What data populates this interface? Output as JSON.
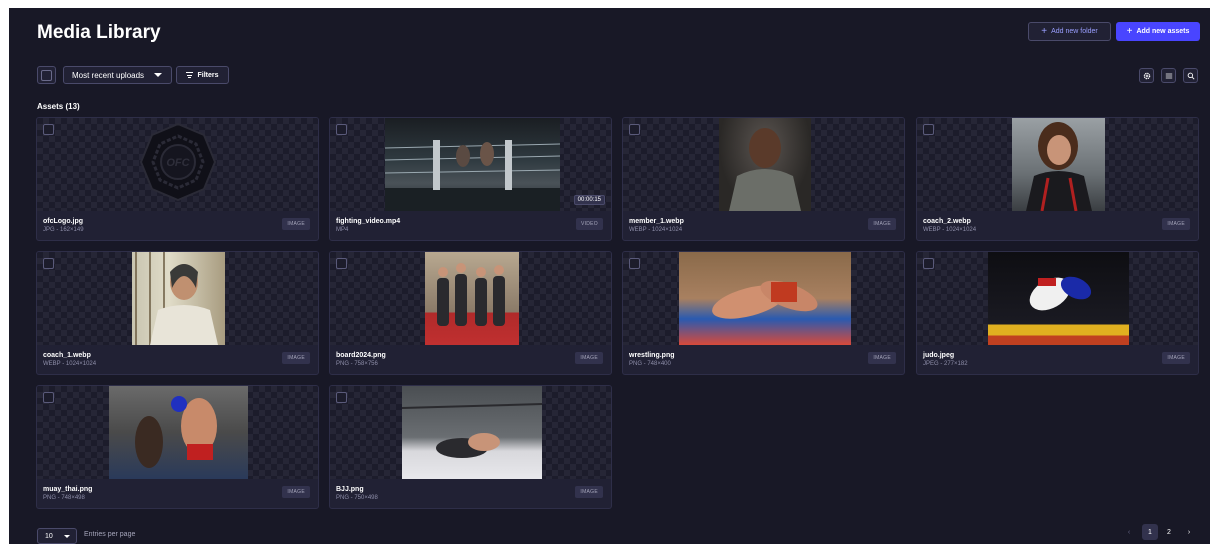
{
  "header": {
    "title": "Media Library",
    "add_folder_label": "Add new folder",
    "add_assets_label": "Add new assets"
  },
  "toolbar": {
    "sort_value": "Most recent uploads",
    "filters_label": "Filters"
  },
  "section_title": "Assets (13)",
  "assets": [
    {
      "name": "ofcLogo.jpg",
      "meta": "JPG - 162×149",
      "type": "IMAGE"
    },
    {
      "name": "fighting_video.mp4",
      "meta": "MP4",
      "type": "VIDEO",
      "duration": "00:00:15"
    },
    {
      "name": "member_1.webp",
      "meta": "WEBP - 1024×1024",
      "type": "IMAGE"
    },
    {
      "name": "coach_2.webp",
      "meta": "WEBP - 1024×1024",
      "type": "IMAGE"
    },
    {
      "name": "coach_1.webp",
      "meta": "WEBP - 1024×1024",
      "type": "IMAGE"
    },
    {
      "name": "board2024.png",
      "meta": "PNG - 758×756",
      "type": "IMAGE"
    },
    {
      "name": "wrestling.png",
      "meta": "PNG - 748×400",
      "type": "IMAGE"
    },
    {
      "name": "judo.jpeg",
      "meta": "JPEG - 277×182",
      "type": "IMAGE"
    },
    {
      "name": "muay_thai.png",
      "meta": "PNG - 748×498",
      "type": "IMAGE"
    },
    {
      "name": "BJJ.png",
      "meta": "PNG - 750×498",
      "type": "IMAGE"
    }
  ],
  "footer": {
    "per_page_value": "10",
    "per_page_label": "Entries per page",
    "pages": [
      "1",
      "2"
    ],
    "current_page": "1"
  },
  "colors": {
    "background": "#181826",
    "card": "#212134",
    "accent": "#4945ff",
    "muted_text": "#8e8ea9"
  }
}
